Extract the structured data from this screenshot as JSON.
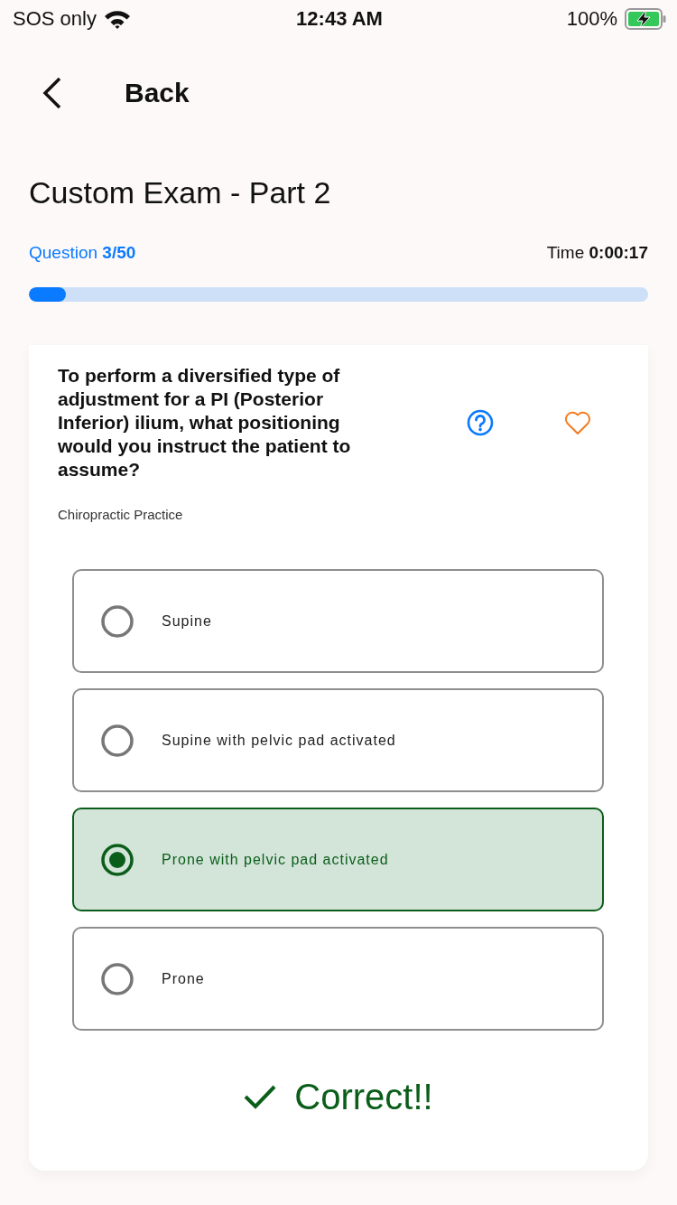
{
  "status_bar": {
    "carrier": "SOS only",
    "time": "12:43 AM",
    "battery": "100%"
  },
  "nav": {
    "back_label": "Back"
  },
  "exam": {
    "title": "Custom Exam - Part 2",
    "question_progress": "Question **3/50**",
    "timer": "Time **0:00:17**",
    "progress": {
      "level": 0.06
    }
  },
  "question": {
    "text": "To perform a diversified type of adjustment for a PI (Posterior Inferior) ilium, what positioning would you instruct the patient to assume?",
    "category": "Chiropractic Practice",
    "favorited": false
  },
  "options": [
    {
      "label": "Supine",
      "selected": false
    },
    {
      "label": "Supine with pelvic pad activated",
      "selected": false
    },
    {
      "label": "Prone with pelvic pad activated",
      "selected": true
    },
    {
      "label": "Prone",
      "selected": false
    }
  ],
  "result": {
    "kind": "correct",
    "text": "Correct!!"
  }
}
